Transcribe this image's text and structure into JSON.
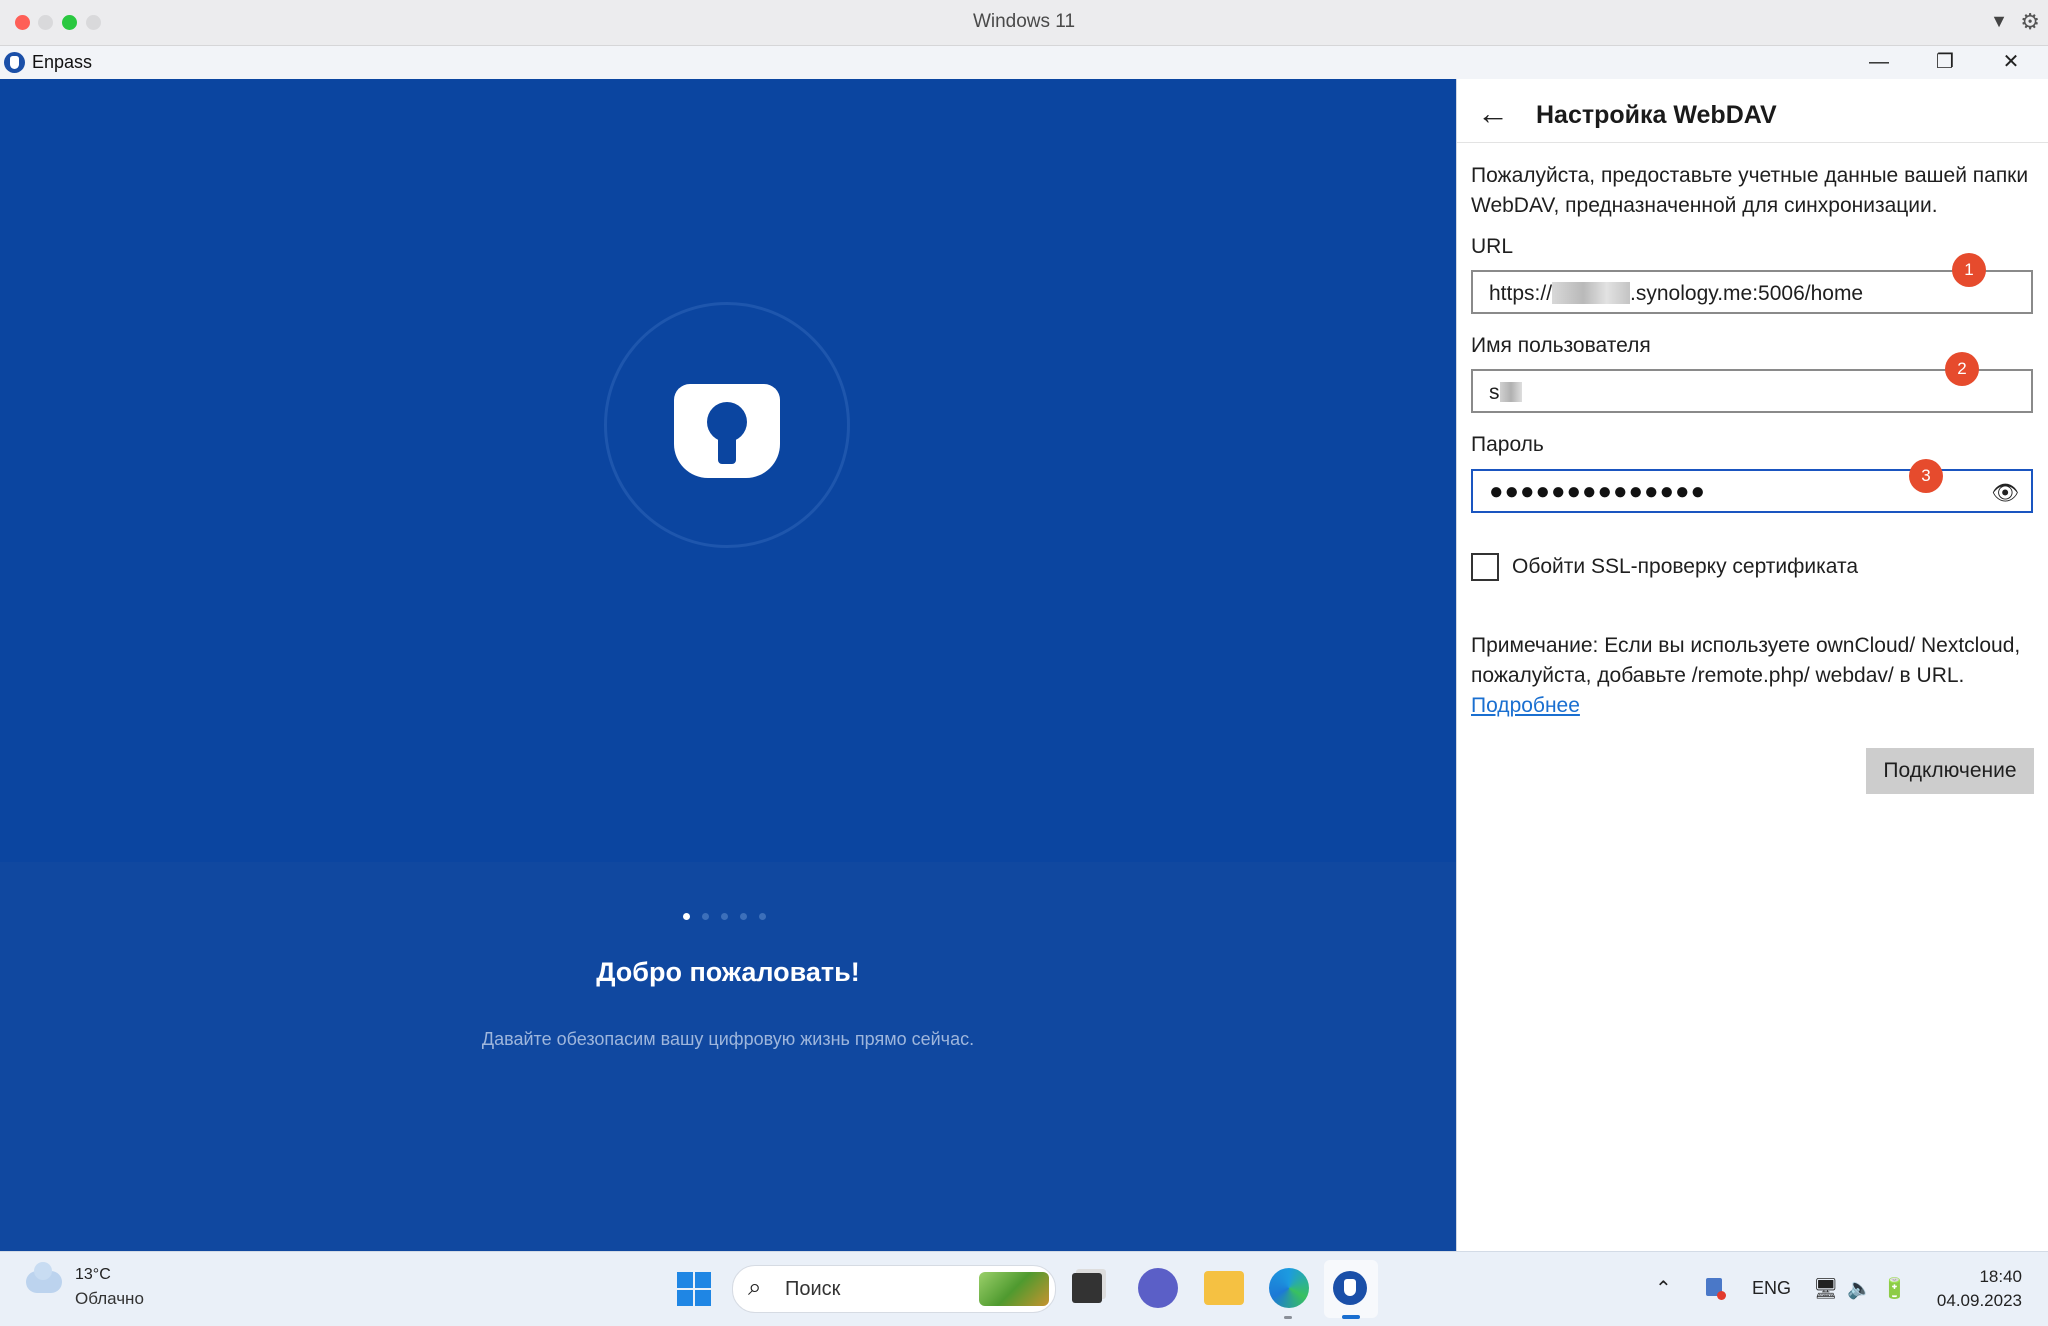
{
  "host": {
    "title": "Windows 11"
  },
  "app": {
    "name": "Enpass"
  },
  "window_controls": {
    "minimize": "—",
    "maximize": "❐",
    "close": "✕"
  },
  "welcome": {
    "title": "Добро пожаловать!",
    "subtitle": "Давайте обезопасим вашу цифровую жизнь прямо сейчас.",
    "page_dots": 5,
    "active_dot": 1
  },
  "webdav": {
    "title": "Настройка WebDAV",
    "intro": "Пожалуйста, предоставьте учетные данные вашей папки WebDAV, предназначенной для синхронизации.",
    "url_label": "URL",
    "url_prefix": "https://",
    "url_suffix": ".synology.me:5006/home",
    "username_label": "Имя пользователя",
    "username_value": "s",
    "password_label": "Пароль",
    "password_mask": "●●●●●●●●●●●●●●",
    "ssl_label": "Обойти SSL-проверку сертификата",
    "ssl_checked": false,
    "note_text": "Примечание: Если вы используете ownCloud/ Nextcloud, пожалуйста, добавьте /remote.php/ webdav/ в URL.",
    "note_link": "Подробнее",
    "connect_button": "Подключение",
    "badges": [
      "1",
      "2",
      "3"
    ]
  },
  "taskbar": {
    "weather_temp": "13°C",
    "weather_desc": "Облачно",
    "search_placeholder": "Поиск",
    "lang": "ENG",
    "time": "18:40",
    "date": "04.09.2023"
  },
  "colors": {
    "brand_blue": "#0b45a0",
    "badge_red": "#e64b2d",
    "link_blue": "#1a6fd0"
  }
}
